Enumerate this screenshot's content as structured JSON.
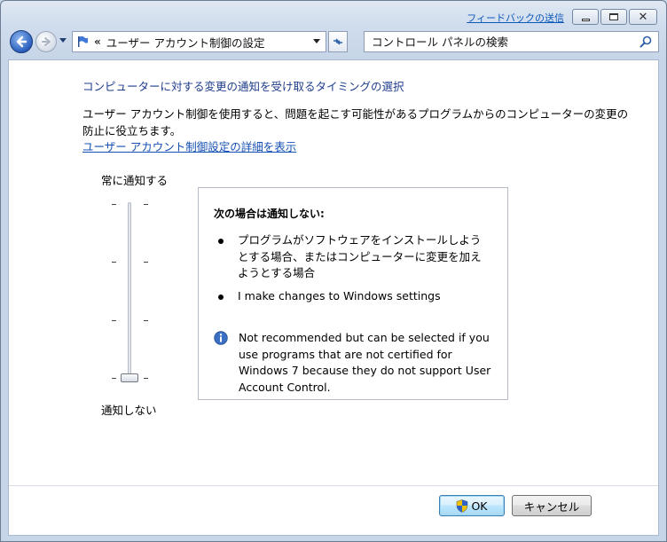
{
  "window": {
    "feedback_link": "フィードバックの送信"
  },
  "nav": {
    "address_chevron": "«",
    "address_text": "ユーザー アカウント制御の設定",
    "search_placeholder": "コントロール パネルの検索"
  },
  "content": {
    "heading": "コンピューターに対する変更の通知を受け取るタイミングの選択",
    "description": "ユーザー アカウント制御を使用すると、問題を起こす可能性があるプログラムからのコンピューターの変更の防止に役立ちます。",
    "details_link": "ユーザー アカウント制御設定の詳細を表示"
  },
  "slider": {
    "label_top": "常に通知する",
    "label_bottom": "通知しない",
    "level_of_4": 1
  },
  "panel": {
    "title": "次の場合は通知しない:",
    "bullets": [
      "プログラムがソフトウェアをインストールしようとする場合、またはコンピューターに変更を加えようとする場合",
      "I make changes to Windows settings"
    ],
    "note": "Not recommended but can be selected if you use programs that are not certified for Windows 7 because they do not support User Account Control."
  },
  "buttons": {
    "ok": "OK",
    "cancel": "キャンセル"
  },
  "colors": {
    "heading": "#1e3c8c",
    "link": "#1550b4",
    "accent": "#3c7fb1"
  }
}
